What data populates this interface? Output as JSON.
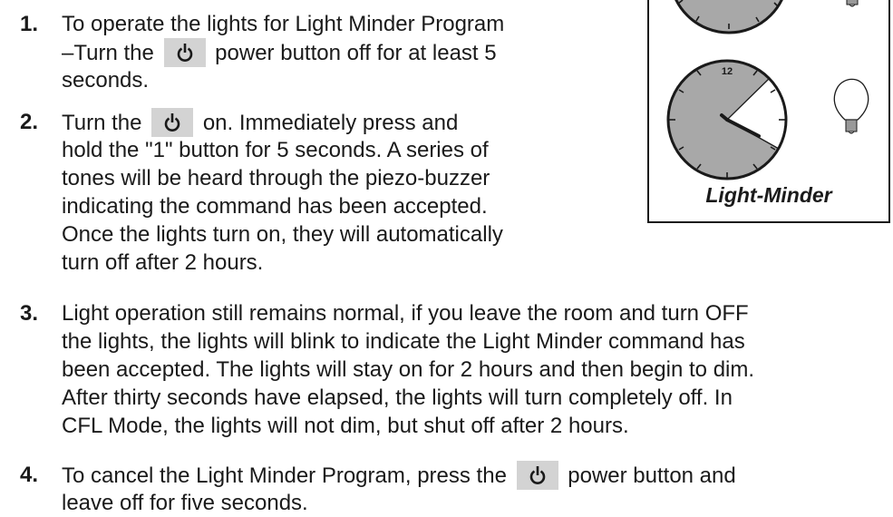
{
  "steps": [
    {
      "number": "1.",
      "lines": [
        [
          "To operate the lights for Light Minder Program"
        ],
        [
          "–Turn the ",
          "power-icon",
          " power button off for at least 5"
        ],
        [
          "seconds."
        ]
      ]
    },
    {
      "number": "2.",
      "lines": [
        [
          "Turn the ",
          "power-icon",
          " on. Immediately press and"
        ],
        [
          "hold the \"1\" button for 5 seconds. A series of"
        ],
        [
          "tones will be heard through the piezo-buzzer"
        ],
        [
          "indicating the command has been accepted."
        ],
        [
          "Once the lights turn on, they will automatically"
        ],
        [
          "turn off after 2 hours."
        ]
      ]
    },
    {
      "number": "3.",
      "lines": [
        [
          "Light operation still remains normal, if you leave the room and turn OFF"
        ],
        [
          "the lights, the lights will blink to indicate the Light Minder command has"
        ],
        [
          "been accepted. The lights will stay on for 2 hours and then begin to dim."
        ],
        [
          "After thirty seconds have elapsed, the lights will turn completely off. In"
        ],
        [
          "CFL Mode, the lights will not dim, but shut off after 2 hours."
        ]
      ]
    },
    {
      "number": "4.",
      "lines": [
        [
          "To cancel the Light Minder Program, press the ",
          "power-icon",
          " power button and"
        ],
        [
          "leave off for five seconds."
        ]
      ]
    }
  ],
  "illustration": {
    "caption": "Light-Minder",
    "clock_numeral": "12",
    "colors": {
      "clock_face": "#a8a8a8",
      "outline": "#1a1a1a",
      "button_bg": "#d3d3d3"
    }
  }
}
